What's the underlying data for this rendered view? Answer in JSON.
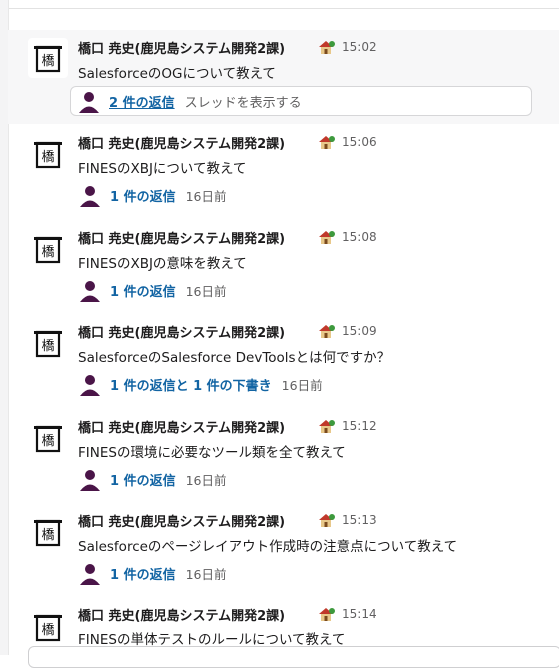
{
  "accent_link_color": "#1264a3",
  "messages": [
    {
      "author": "橋口 尭史(鹿児島システム開発2課)",
      "status_icon": "house-with-tree-icon",
      "time": "15:02",
      "text": "SalesforceのOGについて教えて",
      "reply": "2 件の返信",
      "date": "",
      "hint": "スレッドを表示する"
    },
    {
      "author": "橋口 尭史(鹿児島システム開発2課)",
      "status_icon": "house-with-tree-icon",
      "time": "15:06",
      "text": "FINESのXBJについて教えて",
      "reply": "1 件の返信",
      "date": "16日前",
      "hint": ""
    },
    {
      "author": "橋口 尭史(鹿児島システム開発2課)",
      "status_icon": "house-with-tree-icon",
      "time": "15:08",
      "text": "FINESのXBJの意味を教えて",
      "reply": "1 件の返信",
      "date": "16日前",
      "hint": ""
    },
    {
      "author": "橋口 尭史(鹿児島システム開発2課)",
      "status_icon": "house-with-tree-icon",
      "time": "15:09",
      "text": "SalesforceのSalesforce DevToolsとは何ですか？",
      "reply": "1 件の返信と 1 件の下書き",
      "date": "16日前",
      "hint": ""
    },
    {
      "author": "橋口 尭史(鹿児島システム開発2課)",
      "status_icon": "house-with-tree-icon",
      "time": "15:12",
      "text": "FINESの環境に必要なツール類を全て教えて",
      "reply": "1 件の返信",
      "date": "16日前",
      "hint": ""
    },
    {
      "author": "橋口 尭史(鹿児島システム開発2課)",
      "status_icon": "house-with-tree-icon",
      "time": "15:13",
      "text": "Salesforceのページレイアウト作成時の注意点について教えて",
      "reply": "1 件の返信",
      "date": "16日前",
      "hint": ""
    },
    {
      "author": "橋口 尭史(鹿児島システム開発2課)",
      "status_icon": "house-with-tree-icon",
      "time": "15:14",
      "text": "FINESの単体テストのルールについて教えて",
      "reply": "",
      "date": "",
      "hint": ""
    }
  ]
}
